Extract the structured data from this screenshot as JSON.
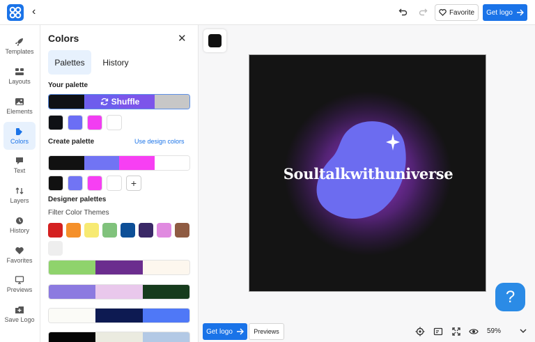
{
  "header": {
    "favorite_label": "Favorite",
    "get_logo_label": "Get logo"
  },
  "rail": {
    "items": [
      {
        "label": "Templates",
        "icon": "rocket-icon"
      },
      {
        "label": "Layouts",
        "icon": "layouts-icon"
      },
      {
        "label": "Elements",
        "icon": "image-icon"
      },
      {
        "label": "Colors",
        "icon": "colors-icon",
        "active": true
      },
      {
        "label": "Text",
        "icon": "text-icon"
      },
      {
        "label": "Layers",
        "icon": "layers-icon"
      },
      {
        "label": "History",
        "icon": "clock-icon"
      },
      {
        "label": "Favorites",
        "icon": "heart-icon"
      },
      {
        "label": "Previews",
        "icon": "monitor-icon"
      },
      {
        "label": "Save Logo",
        "icon": "save-icon"
      }
    ]
  },
  "panel": {
    "title": "Colors",
    "tabs": {
      "palettes": "Palettes",
      "history": "History"
    },
    "your_palette_label": "Your palette",
    "shuffle_label": "Shuffle",
    "your_palette_colors": [
      "#0f1115",
      "#6b6ef5",
      "#f23df2",
      "#ffffff"
    ],
    "create_palette_label": "Create palette",
    "use_design_colors_label": "Use design colors",
    "create_palette_colors": [
      "#111111",
      "#7174f4",
      "#f73ff3",
      "#ffffff"
    ],
    "designer_palettes_label": "Designer palettes",
    "filter_label": "Filter Color Themes",
    "filter_colors": [
      "#d42020",
      "#f5902a",
      "#f7ea72",
      "#80c27c",
      "#0d4f97",
      "#3a2866",
      "#e08ae0",
      "#8f5b42",
      "#eeeeee"
    ],
    "designer_palettes": [
      [
        "#8fd36c",
        "#6b2d8e",
        "#fdf7ee"
      ],
      [
        "#8c7ae0",
        "#e9c8ec",
        "#163b1c"
      ],
      [
        "#fbfbf7",
        "#0d1a52",
        "#4f78f7"
      ],
      [
        "#050505",
        "#ebebe0",
        "#b3c9e5"
      ]
    ]
  },
  "canvas": {
    "brand_name": "Soultalkwithuniverse",
    "background_color": "#141414"
  },
  "footer": {
    "get_logo_label": "Get logo",
    "previews_label": "Previews",
    "zoom": "59%"
  }
}
